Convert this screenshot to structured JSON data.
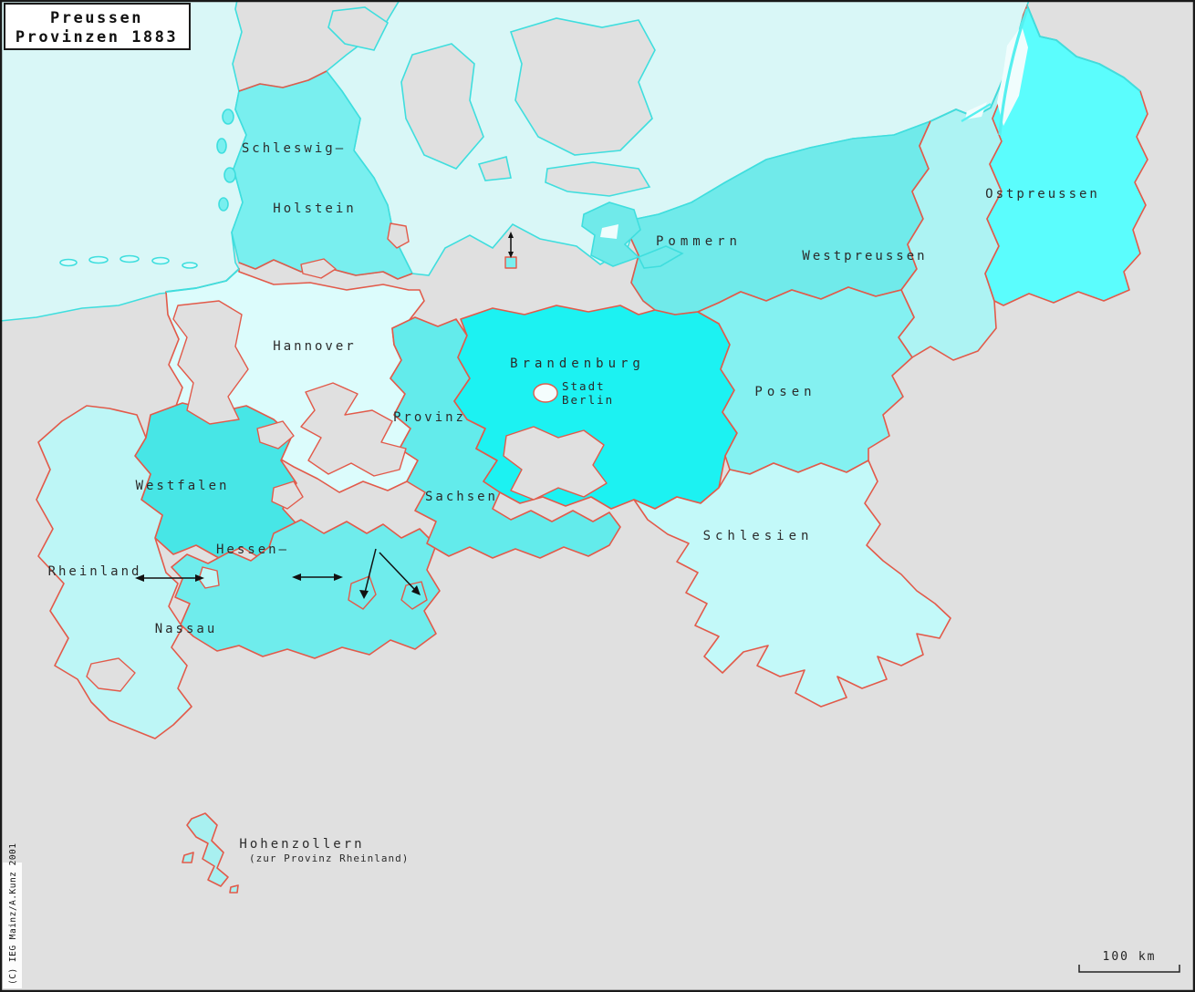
{
  "title": {
    "line1": "Preussen",
    "line2": "Provinzen 1883"
  },
  "labels": {
    "schleswig": "Schleswig—",
    "holstein": "Holstein",
    "hannover": "Hannover",
    "westfalen": "Westfalen",
    "rheinland": "Rheinland",
    "hessen": "Hessen—",
    "nassau": "Nassau",
    "provinz": "Provinz",
    "sachsen": "Sachsen",
    "brandenburg": "Brandenburg",
    "stadt": "Stadt",
    "berlin": "Berlin",
    "pommern": "Pommern",
    "westpreussen": "Westpreussen",
    "ostpreussen": "Ostpreussen",
    "posen": "Posen",
    "schlesien": "Schlesien",
    "hohenzollern": "Hohenzollern",
    "hohenzollern_note": "(zur Provinz Rheinland)"
  },
  "colors": {
    "sea": "#d9f7f7",
    "foreign_land": "#e0e0e0",
    "coastline": "#3fdede",
    "border": "#e25a4a",
    "schleswig_holstein": "#79efef",
    "hannover": "#dcfcfc",
    "westfalen": "#47e6e6",
    "rheinland": "#bdf6f6",
    "hessen_nassau": "#6fecec",
    "provinz_sachsen": "#63ebeb",
    "brandenburg": "#1cf2f2",
    "pommern": "#70eaea",
    "westpreussen": "#adf3f3",
    "ostpreussen": "#5bfdfd",
    "posen": "#84f1f1",
    "schlesien": "#c3f9f9",
    "hohenzollern": "#a8f0f0",
    "berlin_city": "#f4fdfd",
    "lagoon": "#f0fdfd"
  },
  "scale_bar": {
    "label": "100 km"
  },
  "copyright": "(C) IEG Mainz/A.Kunz 2001"
}
